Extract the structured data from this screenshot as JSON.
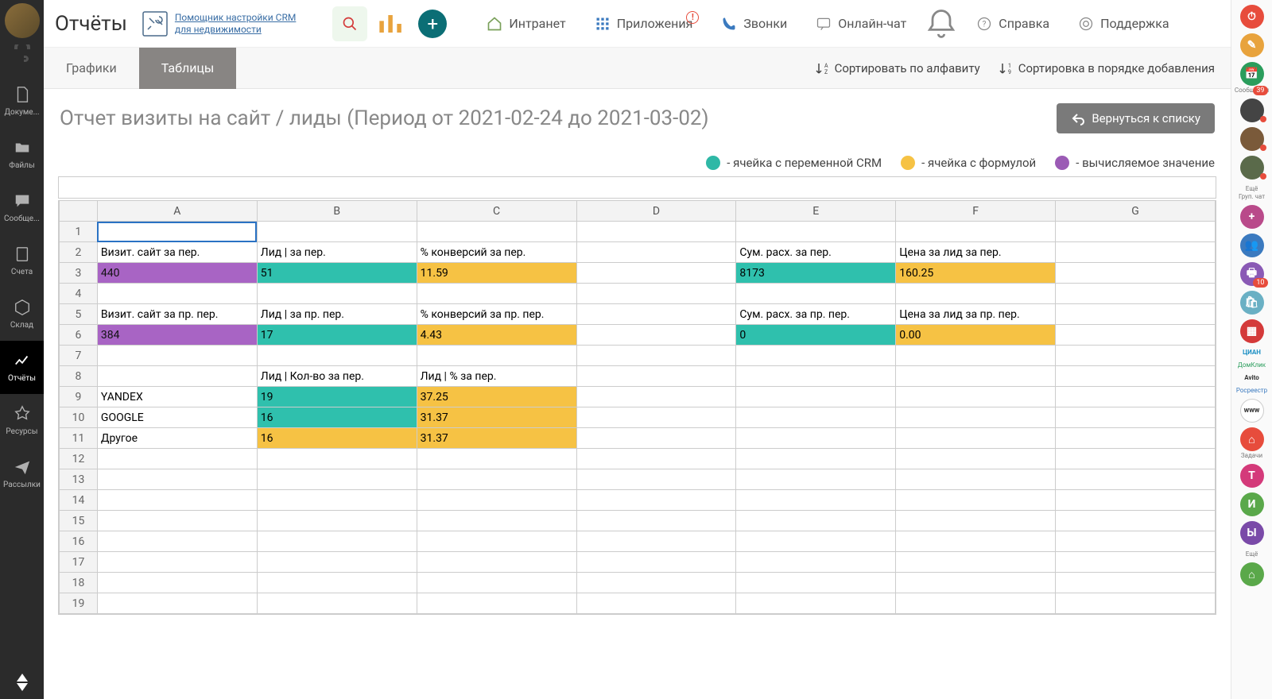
{
  "page_title": "Отчёты",
  "crm_helper": {
    "line1": "Помощник настройки CRM",
    "line2": "для недвижимости"
  },
  "top_nav": {
    "intranet": "Интранет",
    "apps": "Приложения",
    "calls": "Звонки",
    "chat": "Онлайн-чат",
    "help": "Справка",
    "support": "Поддержка"
  },
  "left_nav": {
    "docs": "Докуме...",
    "files": "Файлы",
    "messages": "Сообще...",
    "accounts": "Счета",
    "stock": "Склад",
    "reports": "Отчёты",
    "resources": "Ресурсы",
    "mailings": "Рассылки"
  },
  "tabs": {
    "graphs": "Графики",
    "tables": "Таблицы"
  },
  "sort": {
    "alpha": "Сортировать по алфавиту",
    "added": "Сортировка в порядке добавления"
  },
  "report_title": "Отчет визиты на сайт / лиды (Период от 2021-02-24 до 2021-03-02)",
  "back_button": "Вернуться к списку",
  "legend": {
    "crm_var": "- ячейка с переменной CRM",
    "formula": "- ячейка с формулой",
    "computed": "- вычисляемое значение"
  },
  "columns": [
    "A",
    "B",
    "C",
    "D",
    "E",
    "F",
    "G"
  ],
  "rows": [
    {
      "n": 1,
      "cells": [
        {
          "v": "",
          "sel": true
        },
        {
          "v": ""
        },
        {
          "v": ""
        },
        {
          "v": ""
        },
        {
          "v": ""
        },
        {
          "v": ""
        },
        {
          "v": ""
        }
      ]
    },
    {
      "n": 2,
      "cells": [
        {
          "v": "Визит. сайт за пер."
        },
        {
          "v": "Лид | за пер."
        },
        {
          "v": "% конверсий за пер."
        },
        {
          "v": ""
        },
        {
          "v": "Сум. расх. за пер."
        },
        {
          "v": "Цена за лид за пер."
        },
        {
          "v": ""
        }
      ]
    },
    {
      "n": 3,
      "cells": [
        {
          "v": "440",
          "c": "purple"
        },
        {
          "v": "51",
          "c": "teal"
        },
        {
          "v": "11.59",
          "c": "yellow"
        },
        {
          "v": ""
        },
        {
          "v": "8173",
          "c": "teal"
        },
        {
          "v": "160.25",
          "c": "yellow"
        },
        {
          "v": ""
        }
      ]
    },
    {
      "n": 4,
      "cells": [
        {
          "v": ""
        },
        {
          "v": ""
        },
        {
          "v": ""
        },
        {
          "v": ""
        },
        {
          "v": ""
        },
        {
          "v": ""
        },
        {
          "v": ""
        }
      ]
    },
    {
      "n": 5,
      "cells": [
        {
          "v": "Визит. сайт за пр. пер."
        },
        {
          "v": "Лид | за пр. пер."
        },
        {
          "v": "% конверсий за пр. пер."
        },
        {
          "v": ""
        },
        {
          "v": "Сум. расх. за пр. пер."
        },
        {
          "v": "Цена за лид за пр. пер."
        },
        {
          "v": ""
        }
      ]
    },
    {
      "n": 6,
      "cells": [
        {
          "v": "384",
          "c": "purple"
        },
        {
          "v": "17",
          "c": "teal"
        },
        {
          "v": "4.43",
          "c": "yellow"
        },
        {
          "v": ""
        },
        {
          "v": "0",
          "c": "teal"
        },
        {
          "v": "0.00",
          "c": "yellow"
        },
        {
          "v": ""
        }
      ]
    },
    {
      "n": 7,
      "cells": [
        {
          "v": ""
        },
        {
          "v": ""
        },
        {
          "v": ""
        },
        {
          "v": ""
        },
        {
          "v": ""
        },
        {
          "v": ""
        },
        {
          "v": ""
        }
      ]
    },
    {
      "n": 8,
      "cells": [
        {
          "v": ""
        },
        {
          "v": "Лид | Кол-во за пер."
        },
        {
          "v": "Лид | % за пер."
        },
        {
          "v": ""
        },
        {
          "v": ""
        },
        {
          "v": ""
        },
        {
          "v": ""
        }
      ]
    },
    {
      "n": 9,
      "cells": [
        {
          "v": "YANDEX"
        },
        {
          "v": "19",
          "c": "teal"
        },
        {
          "v": "37.25",
          "c": "yellow"
        },
        {
          "v": ""
        },
        {
          "v": ""
        },
        {
          "v": ""
        },
        {
          "v": ""
        }
      ]
    },
    {
      "n": 10,
      "cells": [
        {
          "v": "GOOGLE"
        },
        {
          "v": "16",
          "c": "teal"
        },
        {
          "v": "31.37",
          "c": "yellow"
        },
        {
          "v": ""
        },
        {
          "v": ""
        },
        {
          "v": ""
        },
        {
          "v": ""
        }
      ]
    },
    {
      "n": 11,
      "cells": [
        {
          "v": "Другое"
        },
        {
          "v": "16",
          "c": "yellow"
        },
        {
          "v": "31.37",
          "c": "yellow"
        },
        {
          "v": ""
        },
        {
          "v": ""
        },
        {
          "v": ""
        },
        {
          "v": ""
        }
      ]
    },
    {
      "n": 12,
      "cells": [
        {
          "v": ""
        },
        {
          "v": ""
        },
        {
          "v": ""
        },
        {
          "v": ""
        },
        {
          "v": ""
        },
        {
          "v": ""
        },
        {
          "v": ""
        }
      ]
    },
    {
      "n": 13,
      "cells": [
        {
          "v": ""
        },
        {
          "v": ""
        },
        {
          "v": ""
        },
        {
          "v": ""
        },
        {
          "v": ""
        },
        {
          "v": ""
        },
        {
          "v": ""
        }
      ]
    },
    {
      "n": 14,
      "cells": [
        {
          "v": ""
        },
        {
          "v": ""
        },
        {
          "v": ""
        },
        {
          "v": ""
        },
        {
          "v": ""
        },
        {
          "v": ""
        },
        {
          "v": ""
        }
      ]
    },
    {
      "n": 15,
      "cells": [
        {
          "v": ""
        },
        {
          "v": ""
        },
        {
          "v": ""
        },
        {
          "v": ""
        },
        {
          "v": ""
        },
        {
          "v": ""
        },
        {
          "v": ""
        }
      ]
    },
    {
      "n": 16,
      "cells": [
        {
          "v": ""
        },
        {
          "v": ""
        },
        {
          "v": ""
        },
        {
          "v": ""
        },
        {
          "v": ""
        },
        {
          "v": ""
        },
        {
          "v": ""
        }
      ]
    },
    {
      "n": 17,
      "cells": [
        {
          "v": ""
        },
        {
          "v": ""
        },
        {
          "v": ""
        },
        {
          "v": ""
        },
        {
          "v": ""
        },
        {
          "v": ""
        },
        {
          "v": ""
        }
      ]
    },
    {
      "n": 18,
      "cells": [
        {
          "v": ""
        },
        {
          "v": ""
        },
        {
          "v": ""
        },
        {
          "v": ""
        },
        {
          "v": ""
        },
        {
          "v": ""
        },
        {
          "v": ""
        }
      ]
    },
    {
      "n": 19,
      "cells": [
        {
          "v": ""
        },
        {
          "v": ""
        },
        {
          "v": ""
        },
        {
          "v": ""
        },
        {
          "v": ""
        },
        {
          "v": ""
        },
        {
          "v": ""
        }
      ]
    }
  ],
  "right_rail": {
    "messages_label": "Сообщения",
    "messages_badge": "39",
    "more": "Ещё",
    "group_chat": "Груп. чат",
    "print_badge": "10",
    "cian": "ЦИАН",
    "domclick": "ДомКлик",
    "avito": "Avito",
    "rosreestr": "Росреестр",
    "tasks": "Задачи",
    "letter_t": "Т",
    "letter_i": "И",
    "letter_y": "Ы"
  }
}
